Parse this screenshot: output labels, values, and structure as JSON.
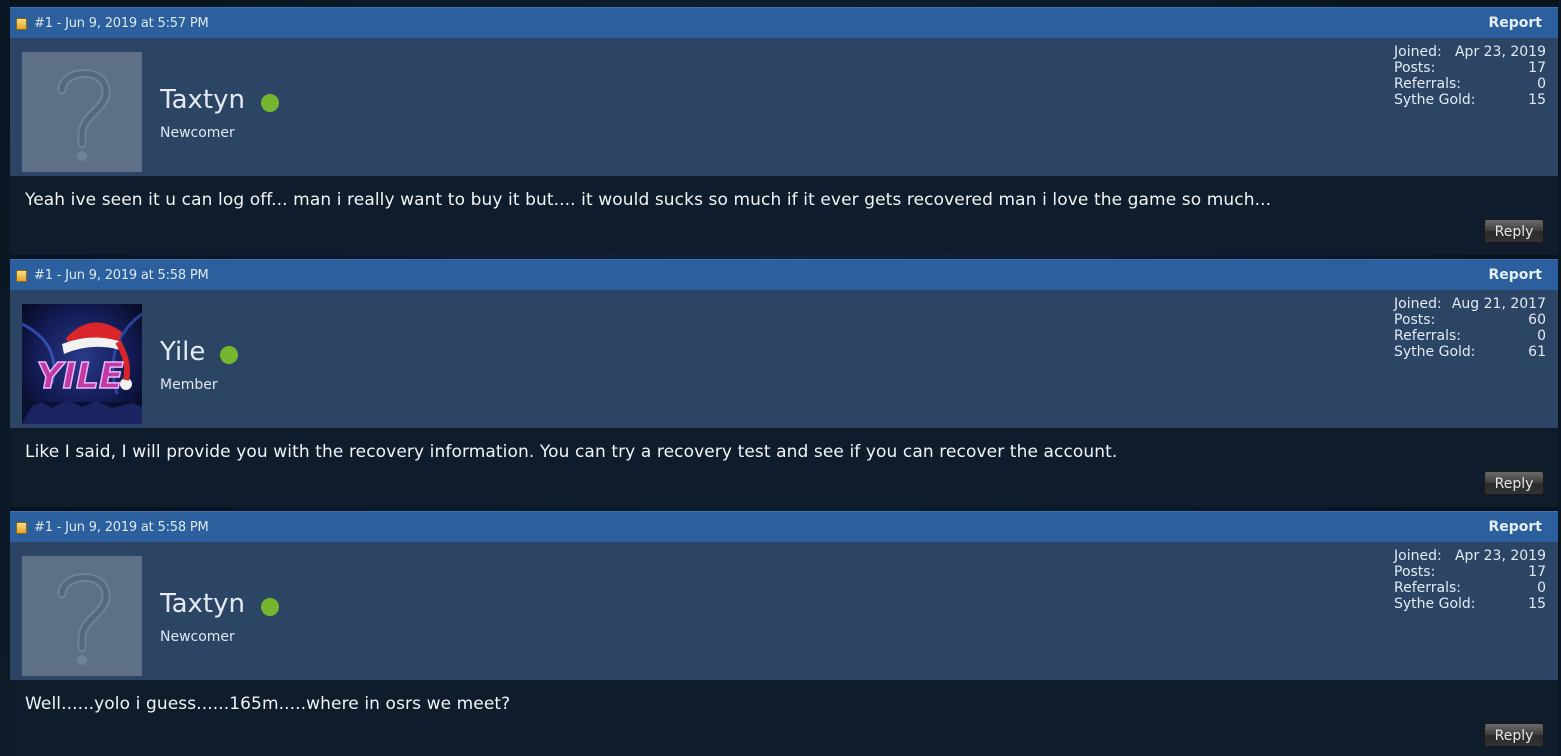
{
  "posts": [
    {
      "meta": "#1 - Jun 9, 2019 at 5:57 PM",
      "report_label": "Report",
      "username": "Taxtyn",
      "user_title": "Newcomer",
      "avatar": "default-question-mark",
      "online_status": "online",
      "stats": [
        {
          "label": "Joined:",
          "value": "Apr 23, 2019"
        },
        {
          "label": "Posts:",
          "value": "17"
        },
        {
          "label": "Referrals:",
          "value": "0"
        },
        {
          "label": "Sythe Gold:",
          "value": "15"
        }
      ],
      "message": "Yeah ive seen it u can log off... man i really want to buy it but.... it would sucks so much if it ever gets recovered man i love the game so much...",
      "reply_label": "Reply"
    },
    {
      "meta": "#1 - Jun 9, 2019 at 5:58 PM",
      "report_label": "Report",
      "username": "Yile",
      "user_title": "Member",
      "avatar": "yile-santa-hat",
      "avatar_text": "YILE",
      "online_status": "online",
      "stats": [
        {
          "label": "Joined:",
          "value": "Aug 21, 2017"
        },
        {
          "label": "Posts:",
          "value": "60"
        },
        {
          "label": "Referrals:",
          "value": "0"
        },
        {
          "label": "Sythe Gold:",
          "value": "61"
        }
      ],
      "message": "Like I said, I will provide you with the recovery information. You can try a recovery test and see if you can recover the account.",
      "reply_label": "Reply"
    },
    {
      "meta": "#1 - Jun 9, 2019 at 5:58 PM",
      "report_label": "Report",
      "username": "Taxtyn",
      "user_title": "Newcomer",
      "avatar": "default-question-mark",
      "online_status": "online",
      "stats": [
        {
          "label": "Joined:",
          "value": "Apr 23, 2019"
        },
        {
          "label": "Posts:",
          "value": "17"
        },
        {
          "label": "Referrals:",
          "value": "0"
        },
        {
          "label": "Sythe Gold:",
          "value": "15"
        }
      ],
      "message": "Well......yolo i guess......165m.....where in osrs we meet?",
      "reply_label": "Reply"
    }
  ],
  "colors": {
    "header_bar": "#2b5f9d",
    "user_panel": "#2d4565",
    "message_panel": "#0f1c2c",
    "online_dot": "#74b72e"
  }
}
